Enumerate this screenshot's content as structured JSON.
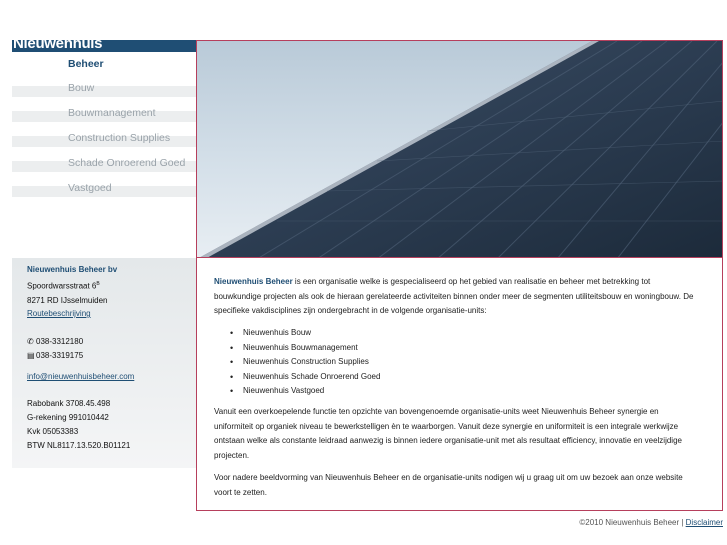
{
  "brand": {
    "name": "Nieuwenhuis"
  },
  "nav": {
    "items": [
      {
        "label": "Beheer",
        "active": true
      },
      {
        "label": "Bouw"
      },
      {
        "label": "Bouwmanagement"
      },
      {
        "label": "Construction Supplies"
      },
      {
        "label": "Schade Onroerend Goed"
      },
      {
        "label": "Vastgoed"
      }
    ]
  },
  "contact": {
    "company": "Nieuwenhuis Beheer bv",
    "street": "Spoordwarsstraat 6",
    "street_suffix": "B",
    "postcode_city": "8271 RD IJsselmuiden",
    "route": "Routebeschrijving",
    "phone": "038-3312180",
    "fax": "038-3319175",
    "email": "info@nieuwenhuisbeheer.com",
    "bank": "Rabobank 3708.45.498",
    "grekening": "G-rekening 991010442",
    "kvk": "Kvk 05053383",
    "btw": "BTW NL8117.13.520.B01121"
  },
  "content": {
    "intro_name": "Nieuwenhuis Beheer",
    "intro_rest": " is een organisatie welke is gespecialiseerd op het gebied van realisatie en beheer met betrekking tot bouwkundige projecten als ook de hieraan gerelateerde activiteiten binnen onder meer de segmenten utiliteitsbouw en woningbouw. De specifieke vakdisciplines zijn ondergebracht in de volgende organisatie-units:",
    "units": [
      "Nieuwenhuis Bouw",
      "Nieuwenhuis Bouwmanagement",
      "Nieuwenhuis Construction Supplies",
      "Nieuwenhuis Schade Onroerend Goed",
      "Nieuwenhuis Vastgoed"
    ],
    "para2": "Vanuit een overkoepelende functie ten opzichte van bovengenoemde organisatie-units weet Nieuwenhuis Beheer synergie en uniformiteit op organiek niveau te bewerkstelligen èn te waarborgen. Vanuit deze synergie en uniformiteit is een integrale werkwijze ontstaan welke als constante leidraad aanwezig is binnen iedere organisatie-unit met als resultaat efficiency, innovatie en veelzijdige projecten.",
    "para3": "Voor nadere beeldvorming van Nieuwenhuis Beheer en de organisatie-units nodigen wij u graag uit om uw bezoek aan onze website voort te zetten."
  },
  "footer": {
    "copyright": "©2010 Nieuwenhuis Beheer | ",
    "disclaimer": "Disclaimer"
  },
  "colors": {
    "brand": "#1f4e74",
    "accent_border": "#b63f5c",
    "nav_inactive": "#9aa3aa"
  },
  "icons": {
    "phone": "phone-icon",
    "fax": "fax-icon"
  }
}
